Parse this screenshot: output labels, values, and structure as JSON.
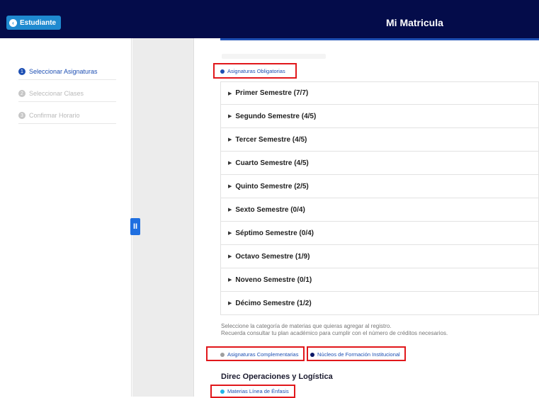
{
  "header": {
    "back_label": "Estudiante",
    "title": "Mi Matricula"
  },
  "sidebar": {
    "steps": [
      {
        "num": "1",
        "label": "Seleccionar Asignaturas",
        "active": true
      },
      {
        "num": "2",
        "label": "Seleccionar Clases",
        "active": false
      },
      {
        "num": "3",
        "label": "Confirmar Horario",
        "active": false
      }
    ]
  },
  "collapse_label": "II",
  "filters": {
    "obligatorias": {
      "label": "Asignaturas Obligatorias",
      "color": "#1d4fb3"
    },
    "complementarias": {
      "label": "Asignaturas Complementarias",
      "color": "#9e9e9e"
    },
    "nucleos": {
      "label": "Núcleos de Formación Institucional",
      "color": "#0b1766"
    },
    "enfasis": {
      "label": "Materias Línea de Énfasis",
      "color": "#21b5e8"
    }
  },
  "semesters": [
    "Primer Semestre (7/7)",
    "Segundo Semestre (4/5)",
    "Tercer Semestre (4/5)",
    "Cuarto Semestre (4/5)",
    "Quinto Semestre (2/5)",
    "Sexto Semestre (0/4)",
    "Séptimo Semestre (0/4)",
    "Octavo Semestre (1/9)",
    "Noveno Semestre (0/1)",
    "Décimo Semestre (1/2)"
  ],
  "helper": {
    "line1": "Seleccione la categoría de materias que quieras agregar al registro.",
    "line2": "Recuerda consultar tu plan académico para cumplir con el número de créditos necesarios."
  },
  "program_title": "Direc Operaciones y Logística",
  "colors": {
    "navy": "#040c4a",
    "accent": "#1f8ad0",
    "highlight": "#e1171b"
  }
}
